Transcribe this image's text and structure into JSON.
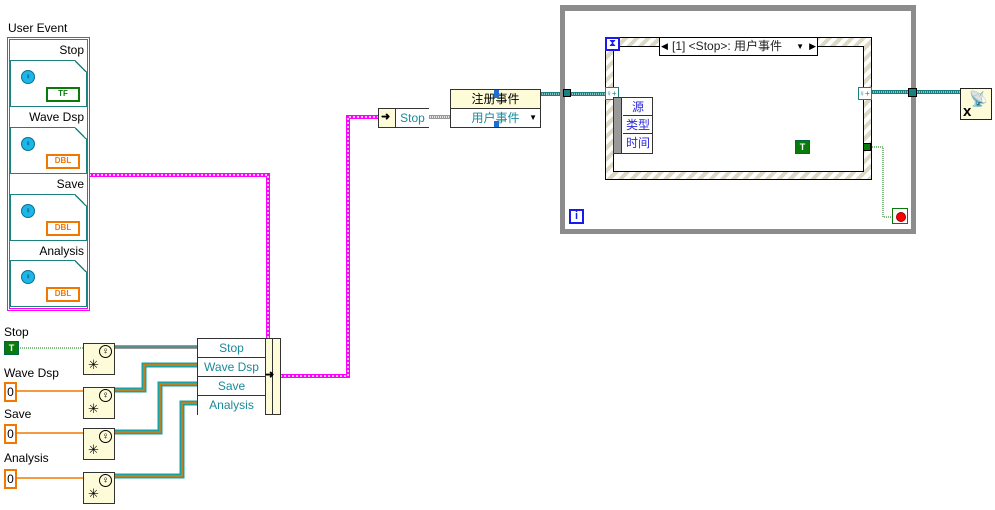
{
  "cluster": {
    "label": "User Event",
    "items": [
      {
        "label": "Stop",
        "type": "TF"
      },
      {
        "label": "Wave Dsp",
        "type": "DBL"
      },
      {
        "label": "Save",
        "type": "DBL"
      },
      {
        "label": "Analysis",
        "type": "DBL"
      }
    ]
  },
  "controls": [
    {
      "label": "Stop",
      "value": "T"
    },
    {
      "label": "Wave Dsp",
      "value": "0"
    },
    {
      "label": "Save",
      "value": "0"
    },
    {
      "label": "Analysis",
      "value": "0"
    }
  ],
  "bundler": {
    "fields": [
      "Stop",
      "Wave Dsp",
      "Save",
      "Analysis"
    ]
  },
  "unbundle": {
    "field": "Stop"
  },
  "register_events": {
    "title": "注册事件",
    "event_type": "用户事件"
  },
  "event_structure": {
    "selector": "[1] <Stop>: 用户事件",
    "data_fields": [
      "源",
      "类型",
      "时间"
    ],
    "bool_const": "T"
  },
  "while_loop": {
    "iteration": "i"
  },
  "colors": {
    "user_event_wire": "#ff00ff",
    "refnum_wire": "#1a8080",
    "dbl": "#f07800",
    "bool": "#0a7a0a",
    "loop_border": "#8c8c8c"
  }
}
